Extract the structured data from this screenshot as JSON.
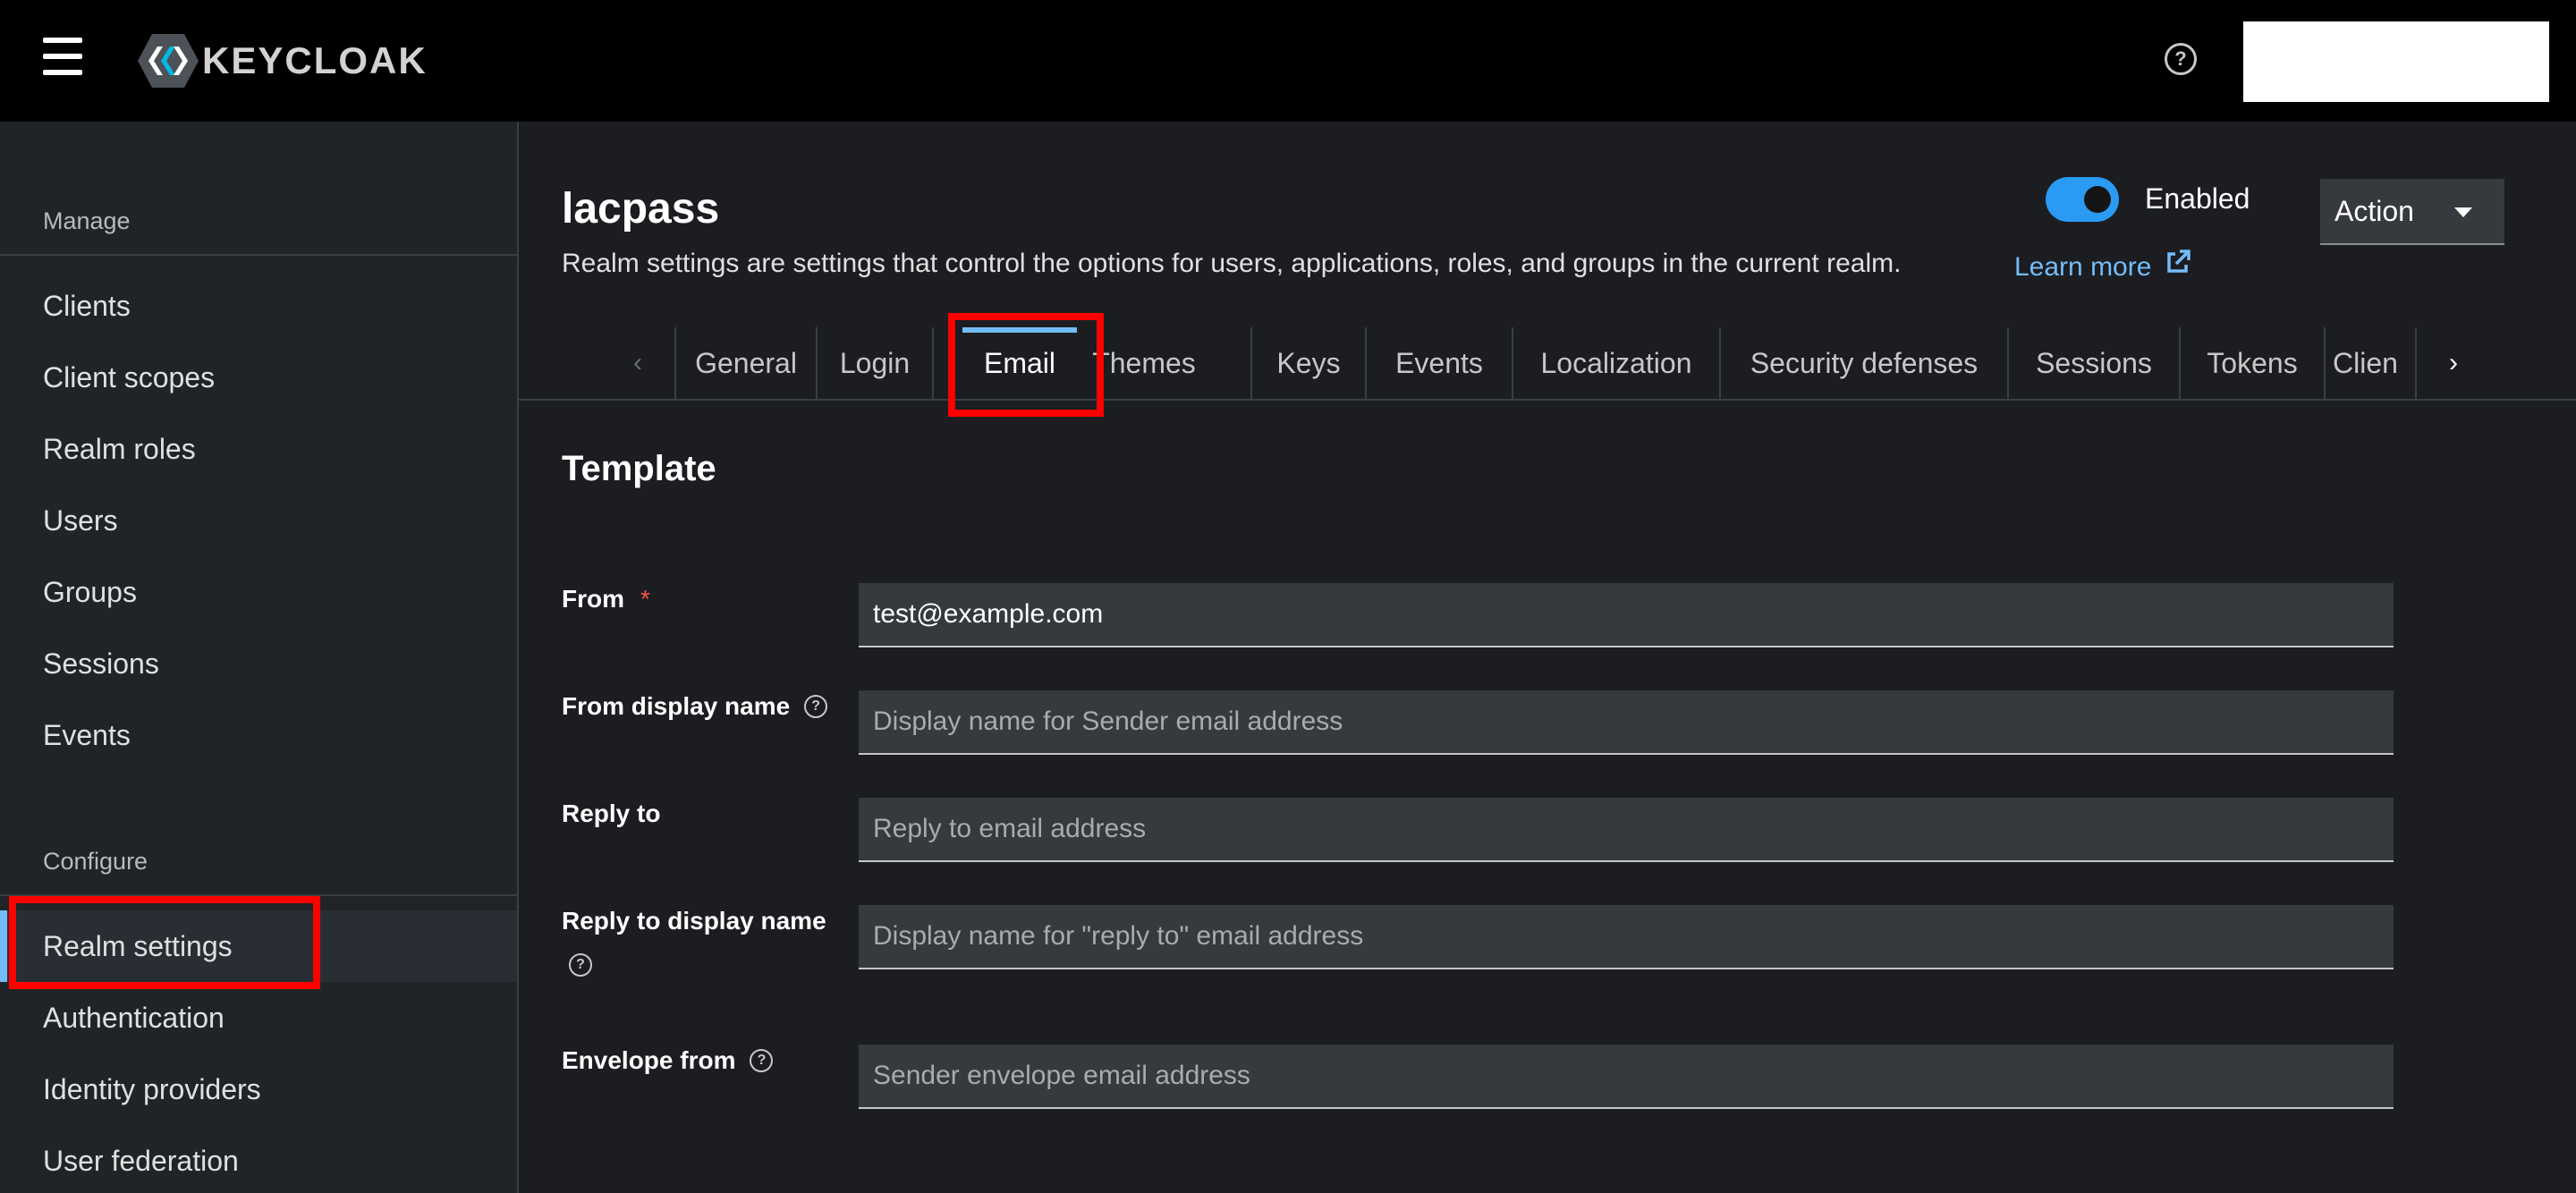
{
  "header": {
    "brand": "KEYCLOAK",
    "help_icon": "help-circle-icon",
    "menu_icon": "hamburger-menu-icon"
  },
  "sidebar": {
    "manage_title": "Manage",
    "manage_items": [
      {
        "label": "Clients"
      },
      {
        "label": "Client scopes"
      },
      {
        "label": "Realm roles"
      },
      {
        "label": "Users"
      },
      {
        "label": "Groups"
      },
      {
        "label": "Sessions"
      },
      {
        "label": "Events"
      }
    ],
    "configure_title": "Configure",
    "configure_items": [
      {
        "label": "Realm settings",
        "active": true
      },
      {
        "label": "Authentication"
      },
      {
        "label": "Identity providers"
      },
      {
        "label": "User federation"
      }
    ]
  },
  "page": {
    "title": "lacpass",
    "description": "Realm settings are settings that control the options for users, applications, roles, and groups in the current realm.",
    "learn_more": "Learn more",
    "enabled_label": "Enabled",
    "enabled": true,
    "action_label": "Action"
  },
  "tabs": [
    {
      "label": "General"
    },
    {
      "label": "Login"
    },
    {
      "label": "Email",
      "active": true
    },
    {
      "label": "Themes"
    },
    {
      "label": "Keys"
    },
    {
      "label": "Events"
    },
    {
      "label": "Localization"
    },
    {
      "label": "Security defenses"
    },
    {
      "label": "Sessions"
    },
    {
      "label": "Tokens"
    },
    {
      "label": "Clien"
    }
  ],
  "form": {
    "section_title": "Template",
    "fields": {
      "from": {
        "label": "From",
        "required_mark": "*",
        "value": "test@example.com"
      },
      "from_display_name": {
        "label": "From display name",
        "placeholder": "Display name for Sender email address"
      },
      "reply_to": {
        "label": "Reply to",
        "placeholder": "Reply to email address"
      },
      "reply_to_display_name": {
        "label": "Reply to display name",
        "placeholder": "Display name for \"reply to\" email address"
      },
      "envelope_from": {
        "label": "Envelope from",
        "placeholder": "Sender envelope email address"
      }
    }
  },
  "colors": {
    "accent": "#73bcf7",
    "toggle_on": "#2b9af3",
    "highlight": "#ff0000",
    "required": "#fe5142"
  }
}
